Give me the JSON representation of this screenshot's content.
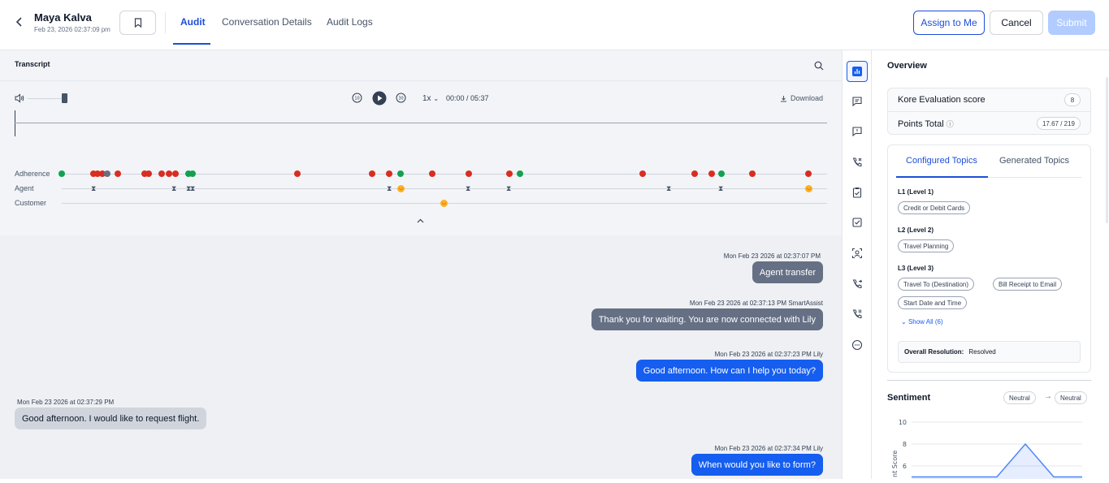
{
  "header": {
    "name": "Maya Kalva",
    "date": "Feb 23, 2026 02:37:09 pm",
    "tabs": [
      "Audit",
      "Conversation Details",
      "Audit Logs"
    ],
    "assign_label": "Assign to Me",
    "cancel_label": "Cancel",
    "submit_label": "Submit"
  },
  "transcript": {
    "title": "Transcript",
    "speed": "1x",
    "time": "00:00 / 05:37",
    "download_label": "Download",
    "tracks": [
      "Adherence",
      "Agent",
      "Customer"
    ]
  },
  "messages": [
    {
      "meta": "Mon Feb 23 2026 at 02:37:07 PM",
      "text": "Agent transfer",
      "style": "gray",
      "side": "right"
    },
    {
      "meta": "Mon Feb 23 2026 at 02:37:13 PM SmartAssist",
      "text": "Thank you for waiting. You are now connected with Lily",
      "style": "gray",
      "side": "right"
    },
    {
      "meta": "Mon Feb 23 2026 at 02:37:23 PM Lily",
      "text": "Good afternoon. How can I help you today?",
      "style": "blue",
      "side": "right"
    },
    {
      "meta": "Mon Feb 23 2026 at 02:37:29 PM",
      "text": "Good afternoon. I would like to request flight.",
      "style": "light",
      "side": "left"
    },
    {
      "meta": "Mon Feb 23 2026 at 02:37:34 PM Lily",
      "text": "When would you like to form?",
      "style": "blue",
      "side": "right"
    }
  ],
  "overview": {
    "title": "Overview",
    "eval_label": "Kore Evaluation score",
    "eval_value": "8",
    "points_label": "Points Total",
    "points_value": "17.67 / 219",
    "topic_tabs": [
      "Configured Topics",
      "Generated Topics"
    ],
    "l1_label": "L1 (Level 1)",
    "l1_tags": [
      "Credit or Debit Cards"
    ],
    "l2_label": "L2 (Level 2)",
    "l2_tags": [
      "Travel Planning"
    ],
    "l3_label": "L3 (Level 3)",
    "l3_tags": [
      "Travel To (Destination)",
      "Bill Receipt to Email",
      "Start Date and Time"
    ],
    "show_all": "Show All (6)",
    "resolution_label": "Overall Resolution:",
    "resolution_value": "Resolved",
    "sentiment_title": "Sentiment",
    "sentiment_from": "Neutral",
    "sentiment_to": "Neutral"
  },
  "chart_data": {
    "type": "area",
    "title": "",
    "ylabel": "nt Score",
    "yticks": [
      10,
      8,
      6
    ],
    "ylim": [
      5,
      10
    ],
    "values": [
      5,
      5,
      5,
      5,
      8,
      5,
      5
    ],
    "color": "#4f86f7"
  }
}
